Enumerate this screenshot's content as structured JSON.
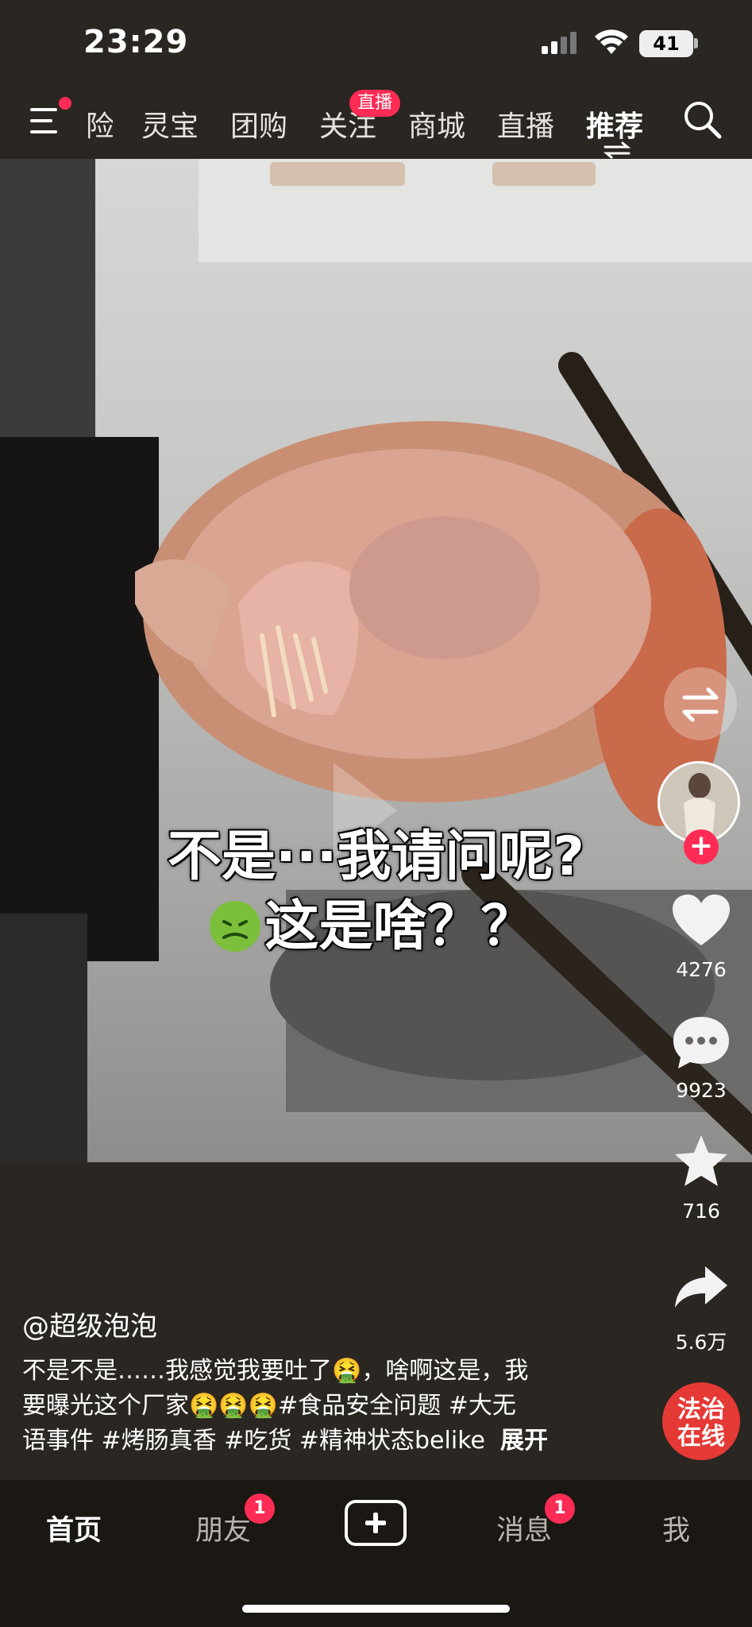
{
  "status_bar": {
    "time": "23:29",
    "battery": "41"
  },
  "top_nav": {
    "tabs": [
      "险",
      "灵宝",
      "团购",
      "关注",
      "商城",
      "直播",
      "推荐"
    ],
    "active_tab": "推荐",
    "live_badge": "直播"
  },
  "video": {
    "subtitle_line1": "不是···我请问呢?",
    "subtitle_line2": "这是啥？？"
  },
  "right_rail": {
    "likes": "4276",
    "comments": "9923",
    "favorites": "716",
    "shares": "5.6万"
  },
  "brand_logo": "法治在线",
  "caption": {
    "author": "@超级泡泡",
    "line1": "不是不是……我感觉我要吐了🤮，啥啊这是，我",
    "line2": "要曝光这个厂家🤮🤮🤮#食品安全问题 #大无",
    "line3": "语事件 #烤肠真香 #吃货 #精神状态belike",
    "expand": "展开"
  },
  "bottom_nav": {
    "home": "首页",
    "friends": "朋友",
    "friends_badge": "1",
    "messages": "消息",
    "messages_badge": "1",
    "me": "我"
  },
  "colors": {
    "accent": "#fe2c55",
    "background": "#2a2622",
    "bottom_bar": "#1b1713"
  }
}
